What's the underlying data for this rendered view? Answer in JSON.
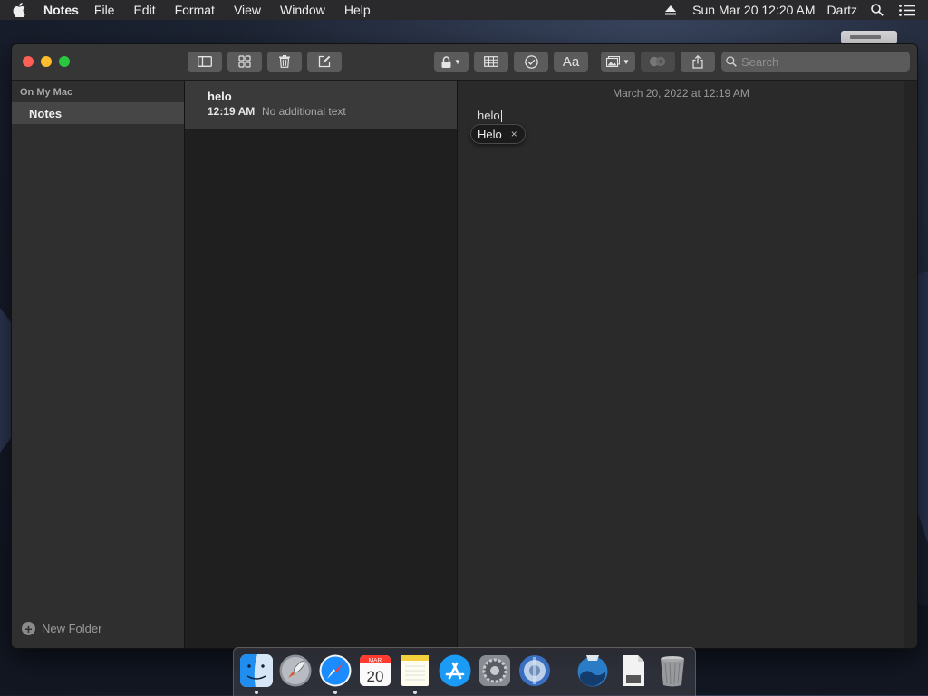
{
  "menubar": {
    "app_name": "Notes",
    "menus": [
      "File",
      "Edit",
      "Format",
      "View",
      "Window",
      "Help"
    ],
    "clock": "Sun Mar 20  12:20 AM",
    "user": "Dartz"
  },
  "toolbar": {
    "search_placeholder": "Search",
    "format_label": "Aa"
  },
  "sidebar": {
    "section_title": "On My Mac",
    "folders": [
      {
        "label": "Notes"
      }
    ],
    "new_folder_label": "New Folder"
  },
  "note_list": {
    "notes": [
      {
        "title": "helo",
        "time": "12:19 AM",
        "preview": "No additional text"
      }
    ]
  },
  "editor": {
    "date": "March 20, 2022 at 12:19 AM",
    "body": "helo",
    "suggestion": "Helo",
    "suggestion_dismiss": "×"
  },
  "dock": {
    "apps": [
      {
        "icon": "finder-icon",
        "running": true
      },
      {
        "icon": "launchpad-icon",
        "running": false
      },
      {
        "icon": "safari-icon",
        "running": true
      },
      {
        "icon": "calendar-icon",
        "month": "MAR",
        "day": "20",
        "running": false
      },
      {
        "icon": "notes-icon",
        "running": true
      },
      {
        "icon": "app-store-icon",
        "running": false
      },
      {
        "icon": "system-preferences-icon",
        "running": false
      },
      {
        "icon": "network-utility-icon",
        "running": false
      },
      {
        "icon": "macos-installer-icon",
        "running": false
      },
      {
        "icon": "document-icon",
        "running": false
      },
      {
        "icon": "trash-icon",
        "running": false
      }
    ]
  },
  "colors": {
    "close": "#fe5f57",
    "minimize": "#febc2e",
    "maximize": "#28c840",
    "accent_blue": "#1a8cff"
  }
}
